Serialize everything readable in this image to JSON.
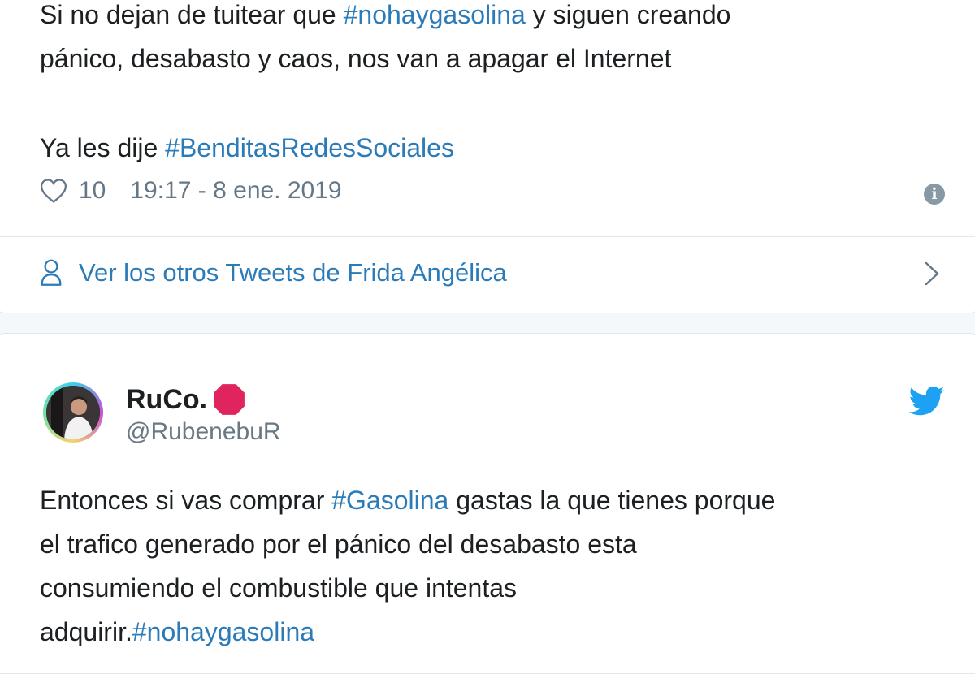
{
  "tweet1": {
    "line1_pre": "Si no dejan de tuitear que ",
    "line1_hashtag": "#nohaygasolina",
    "line1_post": " y siguen creando",
    "line2": "pánico, desabasto y caos, nos van a apagar el Internet",
    "line3_pre": "Ya les dije ",
    "line3_hashtag": "#BenditasRedesSociales",
    "likes": "10",
    "timestamp": "19:17 - 8 ene. 2019",
    "more_tweets_label": "Ver los otros Tweets de Frida Angélica"
  },
  "tweet2": {
    "display_name": "RuCo.",
    "handle": "@RubenebuR",
    "line1_pre": "Entonces si vas comprar ",
    "line1_hashtag": "#Gasolina",
    "line1_post": " gastas la que tienes porque",
    "line2": "el trafico generado por el pánico del desabasto esta",
    "line3": "consumiendo el combustible que intentas",
    "line4_pre": "adquirir.",
    "line4_hashtag": "#nohaygasolina"
  },
  "icons": {
    "heart": "heart-icon",
    "info": "info-icon",
    "person": "person-icon",
    "chevron": "chevron-right-icon",
    "stop": "stop-sign-icon",
    "twitter": "twitter-bird-icon"
  },
  "colors": {
    "link": "#2b7bb9",
    "text": "#1c2022",
    "muted": "#657786",
    "twitter_blue": "#1da1f2",
    "stop_red": "#e0245e"
  }
}
